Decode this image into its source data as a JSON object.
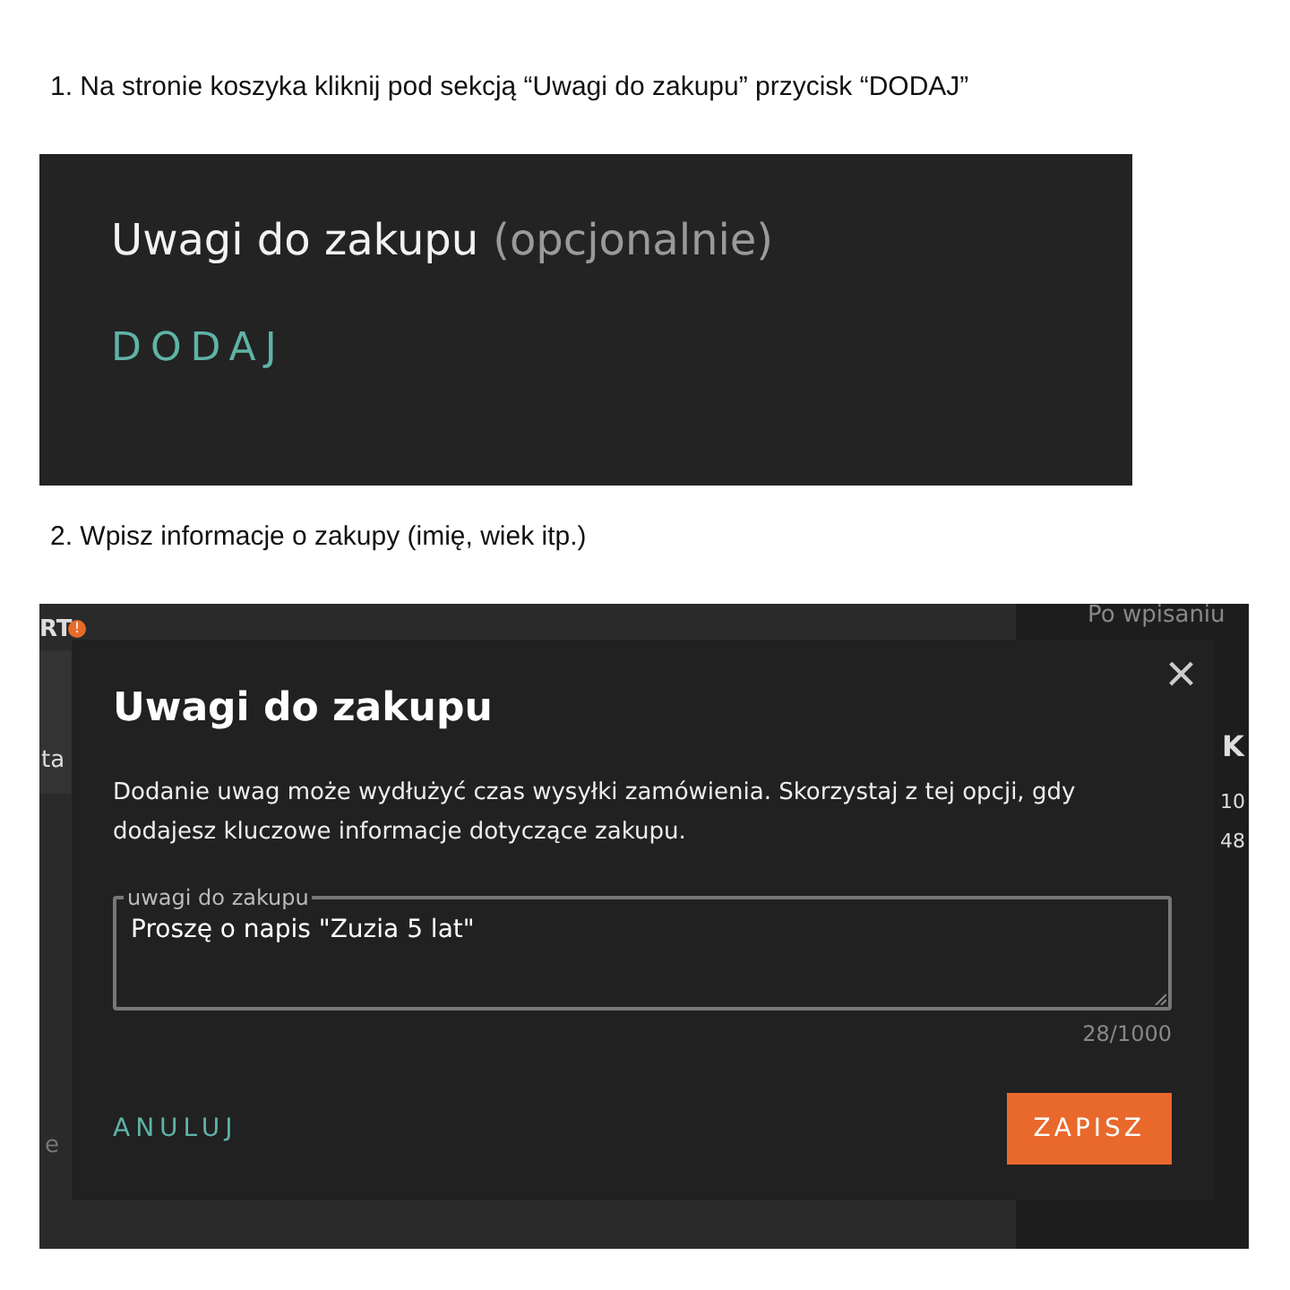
{
  "steps": [
    {
      "number": "1.",
      "text": "Na stronie koszyka kliknij pod sekcją “Uwagi do zakupu” przycisk “DODAJ”"
    },
    {
      "number": "2.",
      "text": "Wpisz informacje o zakupy (imię, wiek itp.)"
    }
  ],
  "section": {
    "title": "Uwagi do zakupu",
    "optional": "(opcjonalnie)",
    "add_button": "DODAJ"
  },
  "background_page": {
    "logo_fragment": "RT",
    "badge": "!",
    "hint_fragment": "Po wpisaniu",
    "left_fragments": [
      "ta",
      "e"
    ],
    "right_heading": "K",
    "right_lines": [
      "10",
      "48"
    ]
  },
  "modal": {
    "title": "Uwagi do zakupu",
    "description": "Dodanie uwag może wydłużyć czas wysyłki zamówienia. Skorzystaj z tej opcji, gdy dodajesz kluczowe informacje dotyczące zakupu.",
    "close": "×",
    "field_label": "uwagi do zakupu",
    "field_value": "Proszę o napis \"Zuzia 5 lat\"",
    "counter": "28/1000",
    "cancel": "ANULUJ",
    "save": "ZAPISZ"
  }
}
